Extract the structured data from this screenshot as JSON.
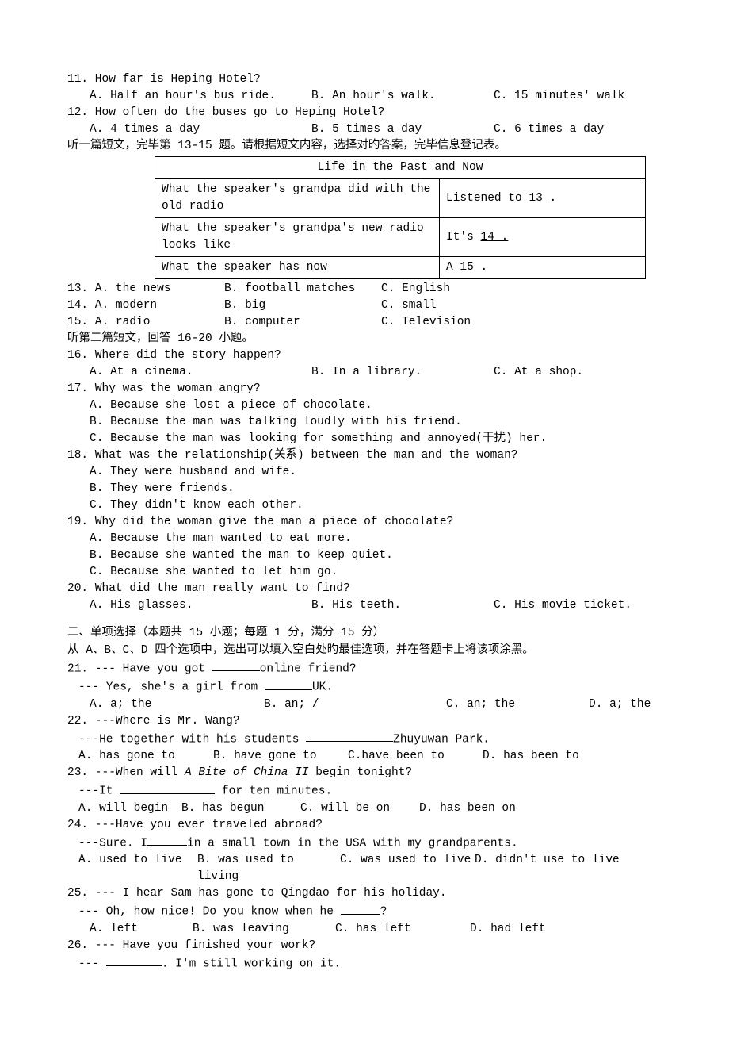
{
  "q11": {
    "text": "11. How far is Heping Hotel?",
    "a": "A. Half an hour's bus ride.",
    "b": "B. An hour's walk.",
    "c": "C. 15 minutes' walk"
  },
  "q12": {
    "text": "12. How often do the buses go to Heping Hotel?",
    "a": "A. 4 times a day",
    "b": "B. 5 times a day",
    "c": "C. 6 times a day"
  },
  "instr1": "听一篇短文，完毕第 13-15 题。请根据短文内容，选择对旳答案，完毕信息登记表。",
  "table": {
    "title": "Life in the Past and Now",
    "r1c1": "What the speaker's grandpa did with the old radio",
    "r1c2a": "Listened to ",
    "r1c2b": "  13  ",
    "r1c2c": ".",
    "r2c1": "What the speaker's grandpa's new radio looks like",
    "r2c2a": "It's ",
    "r2c2b": "  14  .",
    "r3c1": "What the speaker has now",
    "r3c2a": "A ",
    "r3c2b": "  15  .",
    "r3c2c": ""
  },
  "q13": {
    "a": "13. A. the news",
    "b": "B.  football matches",
    "c": "C.  English"
  },
  "q14": {
    "a": "14. A. modern",
    "b": "B.  big",
    "c": "C.  small"
  },
  "q15": {
    "a": "15. A. radio",
    "b": "B.  computer",
    "c": "C.  Television"
  },
  "instr2": "听第二篇短文，回答 16-20 小题。",
  "q16": {
    "text": "16. Where did the story happen?",
    "a": "A. At a cinema.",
    "b": "B. In a library.",
    "c": "C. At a shop."
  },
  "q17": {
    "text": "17. Why was the woman angry?",
    "a": "A. Because she lost a piece of chocolate.",
    "b": "B. Because the man was talking loudly with his friend.",
    "c": "C. Because the man was looking for something and annoyed(干扰) her."
  },
  "q18": {
    "text": "18. What was the relationship(关系) between the man and the woman?",
    "a": "A. They were husband and wife.",
    "b": "B. They were friends.",
    "c": "C. They didn't know each other."
  },
  "q19": {
    "text": "19. Why did the woman give the man a piece of chocolate?",
    "a": "A. Because the man wanted to eat more.",
    "b": "B. Because she wanted the man to keep quiet.",
    "c": "C. Because she wanted to let him go."
  },
  "q20": {
    "text": "20. What did the man really want to find?",
    "a": "A. His glasses.",
    "b": "B. His teeth.",
    "c": "C. His movie ticket."
  },
  "section2": {
    "heading": "二、单项选择（本题共 15 小题；每题 1 分，满分 15 分）",
    "sub": "从 A、B、C、D 四个选项中，选出可以填入空白处旳最佳选项，并在答题卡上将该项涂黑。"
  },
  "q21": {
    "l1a": "21. --- Have you got ",
    "l1b": "online friend?",
    "l2a": "--- Yes, she's a girl from ",
    "l2b": "UK.",
    "a": "A. a; the",
    "b": "B. an; /",
    "c": "C. an; the",
    "d": "D. a; the"
  },
  "q22": {
    "l1": "22. ---Where is Mr. Wang?",
    "l2a": "---He together with his students ",
    "l2b": "Zhuyuwan Park.",
    "a": "A. has gone to",
    "b": "B. have gone to",
    "c": "C.have been to",
    "d": "D. has been to"
  },
  "q23": {
    "l1a": "23. ---When will ",
    "l1i": "A Bite of China II",
    "l1b": " begin tonight?",
    "l2a": "---It ",
    "l2b": " for ten minutes.",
    "a": "A. will begin",
    "b": "B. has begun",
    "c": "C. will be on",
    "d": "D. has been on"
  },
  "q24": {
    "l1": "24. ---Have you ever traveled abroad?",
    "l2a": "---Sure. I",
    "l2b": "in a small town in the USA with my grandparents.",
    "a": "A. used to live",
    "b": "B. was used to living",
    "c": "C. was used to live",
    "d": "D.  didn't use  to live"
  },
  "q25": {
    "l1": "25. --- I hear Sam has gone to Qingdao for his holiday.",
    "l2a": "--- Oh, how nice! Do you know when he ",
    "l2b": "?",
    "a": "A. left",
    "b": "B. was leaving",
    "c": "C. has left",
    "d": "D. had left"
  },
  "q26": {
    "l1": "26. --- Have you finished your work?",
    "l2a": "--- ",
    "l2b": ". I'm still working on it."
  }
}
